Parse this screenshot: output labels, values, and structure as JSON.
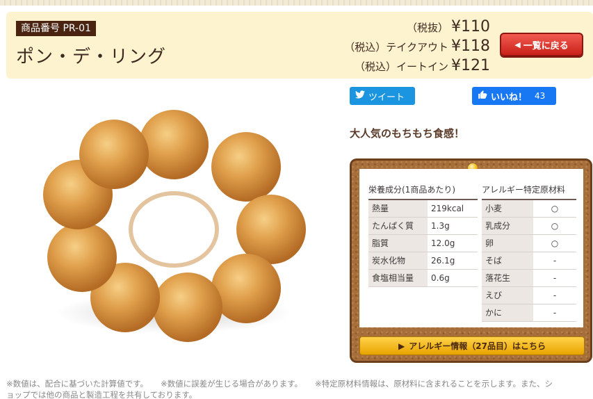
{
  "product": {
    "code_label": "商品番号 PR-01",
    "name": "ポン・デ・リング",
    "catchphrase": "大人気のもちもち食感！"
  },
  "prices": [
    {
      "label": "（税抜）",
      "value": "¥110"
    },
    {
      "label": "（税込）テイクアウト",
      "value": "¥118"
    },
    {
      "label": "（税込）イートイン",
      "value": "¥121"
    }
  ],
  "back_button": {
    "label": "一覧に戻る"
  },
  "social": {
    "tweet_label": "ツイート",
    "like_label": "いいね！",
    "like_count": "43"
  },
  "nutrition": {
    "title": "栄養成分(1商品あたり)",
    "rows": [
      {
        "name": "熱量",
        "value": "219kcal"
      },
      {
        "name": "たんぱく質",
        "value": "1.3g"
      },
      {
        "name": "脂質",
        "value": "12.0g"
      },
      {
        "name": "炭水化物",
        "value": "26.1g"
      },
      {
        "name": "食塩相当量",
        "value": "0.6g"
      }
    ]
  },
  "allergy": {
    "title": "アレルギー特定原材料",
    "rows": [
      {
        "name": "小麦",
        "value": "○"
      },
      {
        "name": "乳成分",
        "value": "○"
      },
      {
        "name": "卵",
        "value": "○"
      },
      {
        "name": "そば",
        "value": "-"
      },
      {
        "name": "落花生",
        "value": "-"
      },
      {
        "name": "えび",
        "value": "-"
      },
      {
        "name": "かに",
        "value": "-"
      }
    ],
    "info_button": "アレルギー情報（27品目）はこちら"
  },
  "footer": {
    "note1": "※数値は、配合に基づいた計算値です。",
    "note2": "※数値に誤差が生じる場合があります。",
    "note3": "※特定原材料情報は、原材料に含まれることを示します。また、シ",
    "note4": "ョップでは他の商品と製造工程を共有しております。"
  },
  "colors": {
    "header_bg": "#fdf3cf",
    "back_button": "#d8322a",
    "tweet": "#1b95e0",
    "like": "#1877f2",
    "cork": "#a66e3a"
  }
}
